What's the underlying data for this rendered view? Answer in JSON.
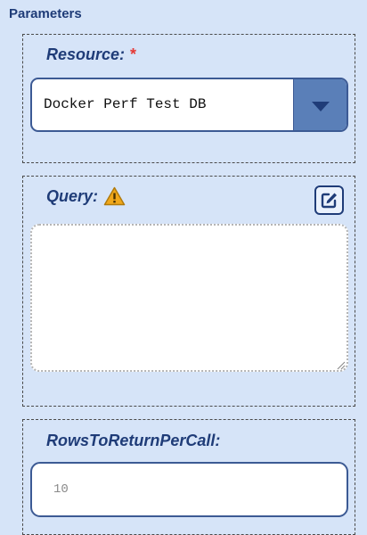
{
  "section": {
    "title": "Parameters"
  },
  "resource": {
    "label": "Resource:",
    "required_mark": "*",
    "selected": "Docker Perf Test DB"
  },
  "query": {
    "label": "Query:",
    "value": "",
    "warning_icon": "warning-triangle-icon",
    "edit_icon": "edit-pencil-square-icon"
  },
  "rows": {
    "label": "RowsToReturnPerCall:",
    "placeholder": "10"
  },
  "colors": {
    "background": "#d6e4f8",
    "label": "#1f3c78",
    "required": "#e53935",
    "accent_button": "#5a7fb8",
    "warning": "#f0a71a"
  }
}
